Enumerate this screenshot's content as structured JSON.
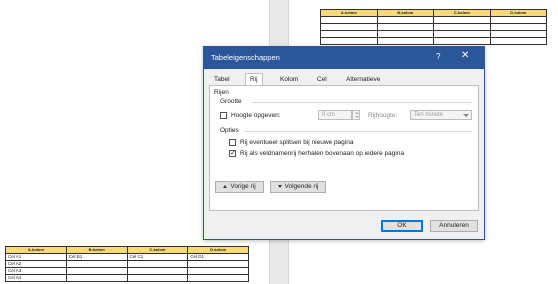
{
  "doc": {
    "top_table": {
      "headers": [
        "A-kolom",
        "B-kolom",
        "C-kolom",
        "D-kolom"
      ],
      "rows": [
        [
          "",
          "",
          "",
          ""
        ],
        [
          "",
          "",
          "",
          ""
        ],
        [
          "",
          "",
          "",
          ""
        ],
        [
          "",
          "",
          "",
          ""
        ]
      ]
    },
    "bottom_table": {
      "headers": [
        "A-kolom",
        "B-kolom",
        "C-kolom",
        "D-kolom"
      ],
      "rows": [
        [
          "Cel A1",
          "Cel B1",
          "Cel C1",
          "Cel D1"
        ],
        [
          "Cel A2",
          "",
          "",
          ""
        ],
        [
          "Cel A3",
          "",
          "",
          ""
        ],
        [
          "Cel A4",
          "",
          "",
          ""
        ]
      ]
    }
  },
  "dialog": {
    "title": "Tabeleigenschappen",
    "help": "?",
    "close": "✕",
    "tabs": [
      "Tabel",
      "Rij",
      "Kolom",
      "Cel",
      "Alternatieve tekst"
    ],
    "active_tab": "Rij",
    "section_rows": "Rijen",
    "section_size": "Grootte",
    "height_label": "Hoogte opgeven:",
    "height_checked": false,
    "height_value": "0 cm",
    "rowheight_label": "Rijhoogte:",
    "rowheight_value": "Ten minste",
    "section_options": "Opties",
    "opt_split": "Rij eventueel splitsen bij nieuwe pagina",
    "opt_split_checked": false,
    "opt_repeat": "Rij als veldnamenrij herhalen bovenaan op iedere pagina",
    "opt_repeat_checked": true,
    "prev_row": "Vorige rij",
    "next_row": "Volgende rij",
    "ok": "OK",
    "cancel": "Annuleren"
  }
}
